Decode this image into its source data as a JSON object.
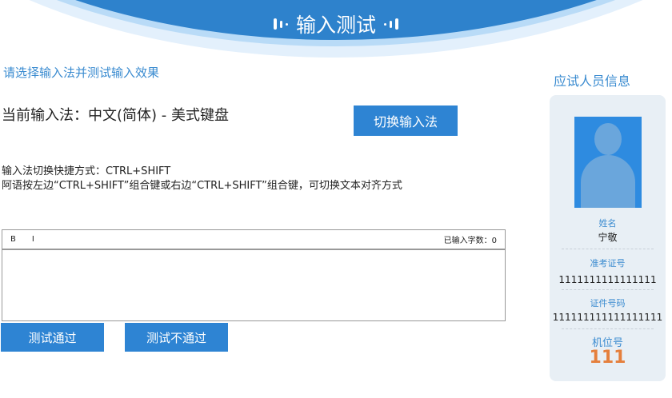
{
  "header": {
    "title": "输入测试"
  },
  "subtitle": "请选择输入法并测试输入效果",
  "current_ime": "当前输入法：中文(简体) - 美式键盘",
  "switch_button": "切换输入法",
  "hints": [
    "输入法切换快捷方式：CTRL+SHIFT",
    "阿语按左边“CTRL+SHIFT”组合键或右边“CTRL+SHIFT”组合键，可切换文本对齐方式"
  ],
  "editor": {
    "bold": "B",
    "italic": "I",
    "count_label": "已输入字数：0",
    "value": ""
  },
  "buttons": {
    "pass": "测试通过",
    "fail": "测试不通过"
  },
  "sidebar": {
    "title": "应试人员信息",
    "name_label": "姓名",
    "name": "宁敬",
    "exam_id_label": "准考证号",
    "exam_id": "1111111111111111",
    "id_label": "证件号码",
    "id_number": "111111111111111111",
    "seat_label": "机位号",
    "seat": "111"
  }
}
